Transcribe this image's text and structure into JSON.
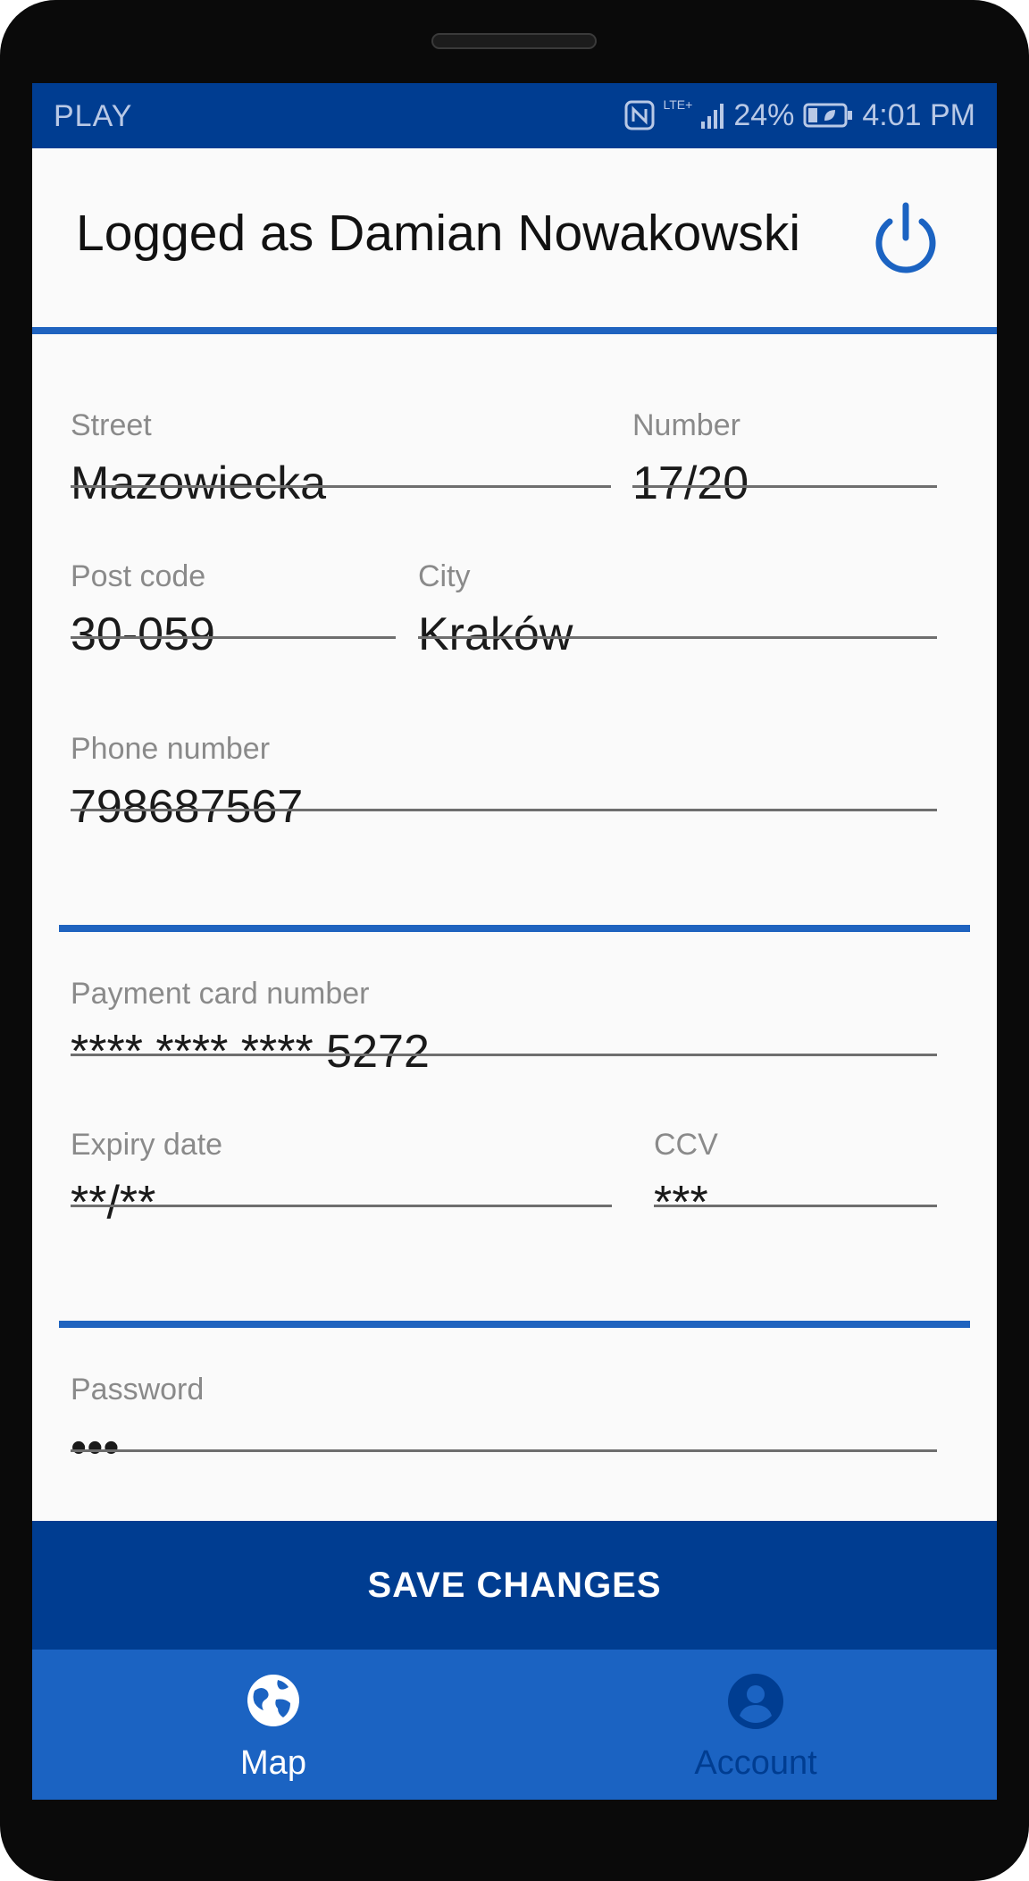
{
  "status_bar": {
    "carrier": "PLAY",
    "network": "LTE+",
    "battery": "24%",
    "time": "4:01 PM"
  },
  "header": {
    "title": "Logged as Damian Nowakowski",
    "logout_icon": "power-icon"
  },
  "address": {
    "street_label": "Street",
    "street_value": "Mazowiecka",
    "number_label": "Number",
    "number_value": "17/20",
    "postcode_label": "Post code",
    "postcode_value": "30-059",
    "city_label": "City",
    "city_value": "Kraków",
    "phone_label": "Phone number",
    "phone_value": "798687567"
  },
  "payment": {
    "card_label": "Payment card number",
    "card_value": "**** **** **** 5272",
    "expiry_label": "Expiry date",
    "expiry_value": "**/**",
    "ccv_label": "CCV",
    "ccv_value": "***"
  },
  "security": {
    "password_label": "Password",
    "password_value": "•••"
  },
  "actions": {
    "save_label": "SAVE CHANGES"
  },
  "nav": {
    "items": [
      {
        "label": "Map",
        "icon": "globe-icon",
        "active": true
      },
      {
        "label": "Account",
        "icon": "account-icon",
        "active": false
      }
    ]
  },
  "colors": {
    "primary_dark": "#003d91",
    "primary": "#1b63c2",
    "accent_line": "#1f63bf"
  }
}
